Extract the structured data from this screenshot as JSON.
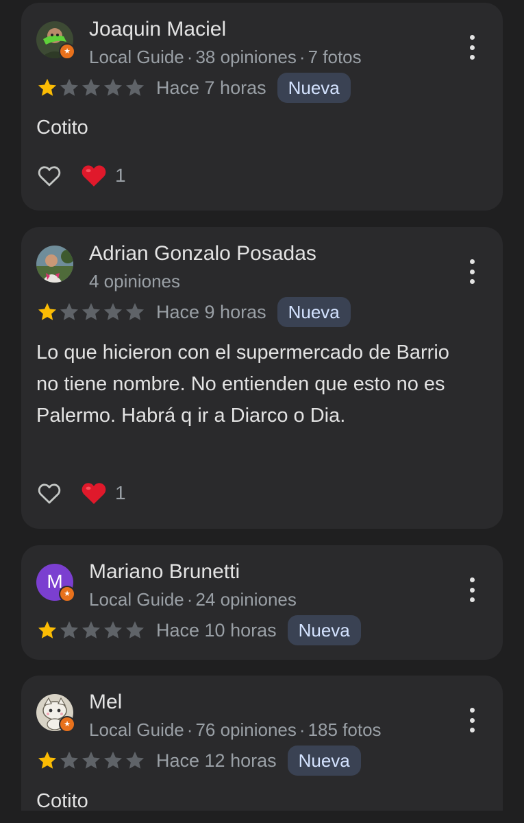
{
  "reviews": [
    {
      "name": "Joaquin Maciel",
      "avatar_type": "photo",
      "local_guide": true,
      "meta": [
        "Local Guide",
        "38 opiniones",
        "7 fotos"
      ],
      "rating": 1,
      "time": "Hace 7 horas",
      "badge": "Nueva",
      "text": "Cotito",
      "reaction_count": "1"
    },
    {
      "name": "Adrian Gonzalo Posadas",
      "avatar_type": "photo",
      "local_guide": false,
      "meta": [
        "4 opiniones"
      ],
      "rating": 1,
      "time": "Hace 9 horas",
      "badge": "Nueva",
      "text": "Lo que hicieron con el supermercado de Barrio no tiene nombre. No entienden que esto no es Palermo. Habrá q ir a Diarco o Dia.",
      "reaction_count": "1"
    },
    {
      "name": "Mariano Brunetti",
      "avatar_type": "letter",
      "avatar_letter": "M",
      "local_guide": true,
      "meta": [
        "Local Guide",
        "24 opiniones"
      ],
      "rating": 1,
      "time": "Hace 10 horas",
      "badge": "Nueva",
      "text": "",
      "reaction_count": ""
    },
    {
      "name": "Mel",
      "avatar_type": "photo",
      "local_guide": true,
      "meta": [
        "Local Guide",
        "76 opiniones",
        "185 fotos"
      ],
      "rating": 1,
      "time": "Hace 12 horas",
      "badge": "Nueva",
      "text": "Cotito",
      "reaction_count": ""
    }
  ],
  "max_rating": 5,
  "icons": {
    "more": "more-vert-icon",
    "like": "heart-outline-icon",
    "reaction": "red-heart-emoji",
    "guide_badge": "local-guide-star-icon"
  },
  "colors": {
    "background": "#1f1f20",
    "card": "#2a2a2c",
    "star_filled": "#fbbc04",
    "star_empty": "#5f6368",
    "badge_bg": "#3a4253",
    "badge_text": "#d4e3ff",
    "letter_avatar": "#7b3fd0",
    "guide_badge": "#e8711c",
    "heart": "#e0192b"
  }
}
